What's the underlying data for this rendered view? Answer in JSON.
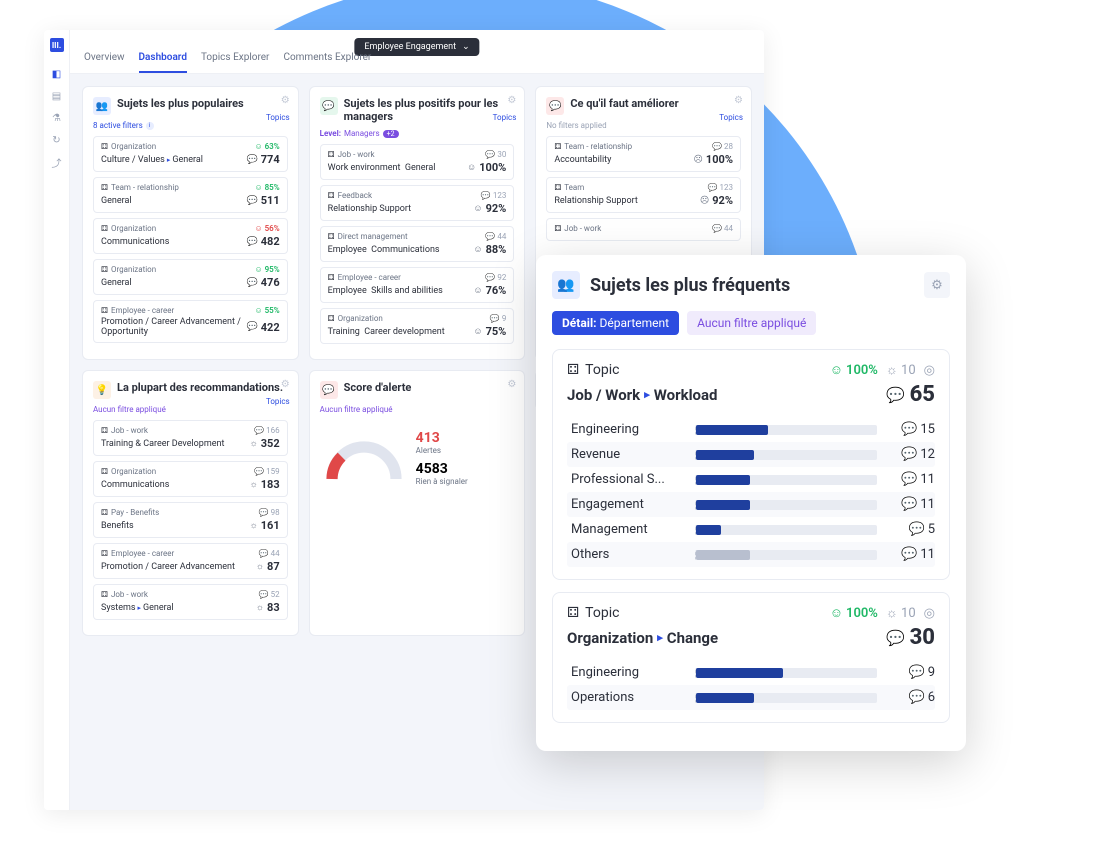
{
  "logo": "III.",
  "topbar": {
    "dropdown": "Employee Engagement",
    "tabs": [
      "Overview",
      "Dashboard",
      "Topics Explorer",
      "Comments Explorer"
    ],
    "active_tab": 1
  },
  "cards": {
    "popular": {
      "title": "Sujets les plus populaires",
      "topics_link": "Topics",
      "filter": "8 active filters",
      "items": [
        {
          "cat": "Organization",
          "pct": "63%",
          "pct_color": "green",
          "name": "Culture / Values",
          "sub": "General",
          "count": "774",
          "count_icon": "bubble"
        },
        {
          "cat": "Team - relationship",
          "pct": "85%",
          "pct_color": "green",
          "name": "General",
          "sub": "",
          "count": "511",
          "count_icon": "bubble"
        },
        {
          "cat": "Organization",
          "pct": "56%",
          "pct_color": "red",
          "name": "Communications",
          "sub": "",
          "count": "482",
          "count_icon": "bubble"
        },
        {
          "cat": "Organization",
          "pct": "95%",
          "pct_color": "green",
          "name": "General",
          "sub": "",
          "count": "476",
          "count_icon": "bubble"
        },
        {
          "cat": "Employee - career",
          "pct": "55%",
          "pct_color": "green",
          "name": "Promotion / Career Advancement / Opportunity",
          "sub": "",
          "count": "422",
          "count_icon": "bubble"
        }
      ]
    },
    "positive": {
      "title": "Sujets les plus positifs pour les managers",
      "topics_link": "Topics",
      "filter_prefix": "Level:",
      "filter_value": "Managers",
      "filter_badge": "+2",
      "items": [
        {
          "cat": "Job - work",
          "top_count": "30",
          "name": "Work environment",
          "sub": "General",
          "pct": "100%"
        },
        {
          "cat": "Feedback",
          "top_count": "123",
          "name": "Relationship Support",
          "sub": "",
          "pct": "92%"
        },
        {
          "cat": "Direct management",
          "top_count": "44",
          "name": "Employee",
          "sub": "Communications",
          "pct": "88%"
        },
        {
          "cat": "Employee - career",
          "top_count": "92",
          "name": "Employee",
          "sub": "Skills and abilities",
          "pct": "76%"
        },
        {
          "cat": "Organization",
          "top_count": "9",
          "name": "Training",
          "sub": "Career development",
          "pct": "75%"
        }
      ]
    },
    "improve": {
      "title": "Ce qu'il faut améliorer",
      "topics_link": "Topics",
      "filter": "No filters applied",
      "items": [
        {
          "cat": "Team - relationship",
          "top_count": "28",
          "name": "Accountability",
          "sub": "",
          "pct": "100%",
          "pct_color": "red"
        },
        {
          "cat": "Team",
          "top_count": "123",
          "name": "Relationship Support",
          "sub": "",
          "pct": "92%",
          "pct_color": "red"
        },
        {
          "cat": "Job - work",
          "top_count": "44",
          "name": "",
          "sub": "",
          "pct": "",
          "pct_color": ""
        }
      ]
    },
    "recommend": {
      "title": "La plupart des recommandations.",
      "topics_link": "Topics",
      "filter": "Aucun filtre appliqué",
      "items": [
        {
          "cat": "Job - work",
          "top_count": "166",
          "name": "Training & Career Development",
          "sub": "",
          "count": "352"
        },
        {
          "cat": "Organization",
          "top_count": "159",
          "name": "Communications",
          "sub": "",
          "count": "183"
        },
        {
          "cat": "Pay - Benefits",
          "top_count": "98",
          "name": "Benefits",
          "sub": "",
          "count": "161"
        },
        {
          "cat": "Employee - career",
          "top_count": "44",
          "name": "Promotion / Career Advancement",
          "sub": "",
          "count": "87"
        },
        {
          "cat": "Job - work",
          "top_count": "52",
          "name": "Systems",
          "sub": "General",
          "count": "83"
        }
      ]
    },
    "alert": {
      "title": "Score d'alerte",
      "filter": "Aucun filtre appliqué",
      "alerts_num": "413",
      "alerts_label": "Alertes",
      "ok_num": "4583",
      "ok_label": "Rien à signaler"
    }
  },
  "detail": {
    "title": "Sujets les plus fréquents",
    "filter_detail_label": "Détail:",
    "filter_detail_value": "Département",
    "filter_none": "Aucun filtre appliqué",
    "sections": [
      {
        "topic_label": "Topic",
        "pct": "100%",
        "light": "10",
        "path_a": "Job / Work",
        "path_b": "Workload",
        "total": "65",
        "rows": [
          {
            "name": "Engineering",
            "count": "15",
            "width": 40
          },
          {
            "name": "Revenue",
            "count": "12",
            "width": 32
          },
          {
            "name": "Professional S...",
            "count": "11",
            "width": 30
          },
          {
            "name": "Engagement",
            "count": "11",
            "width": 30
          },
          {
            "name": "Management",
            "count": "5",
            "width": 14
          },
          {
            "name": "Others",
            "count": "11",
            "width": 30,
            "gray": true
          }
        ]
      },
      {
        "topic_label": "Topic",
        "pct": "100%",
        "light": "10",
        "path_a": "Organization",
        "path_b": "Change",
        "total": "30",
        "rows": [
          {
            "name": "Engineering",
            "count": "9",
            "width": 48
          },
          {
            "name": "Operations",
            "count": "6",
            "width": 32
          }
        ]
      }
    ]
  },
  "chart_data": [
    {
      "type": "bar",
      "title": "Job / Work ▸ Workload",
      "categories": [
        "Engineering",
        "Revenue",
        "Professional S...",
        "Engagement",
        "Management",
        "Others"
      ],
      "values": [
        15,
        12,
        11,
        11,
        5,
        11
      ],
      "total": 65
    },
    {
      "type": "bar",
      "title": "Organization ▸ Change",
      "categories": [
        "Engineering",
        "Operations"
      ],
      "values": [
        9,
        6
      ],
      "total": 30
    },
    {
      "type": "pie",
      "title": "Score d'alerte",
      "series": [
        {
          "name": "Alertes",
          "value": 413
        },
        {
          "name": "Rien à signaler",
          "value": 4583
        }
      ]
    }
  ]
}
